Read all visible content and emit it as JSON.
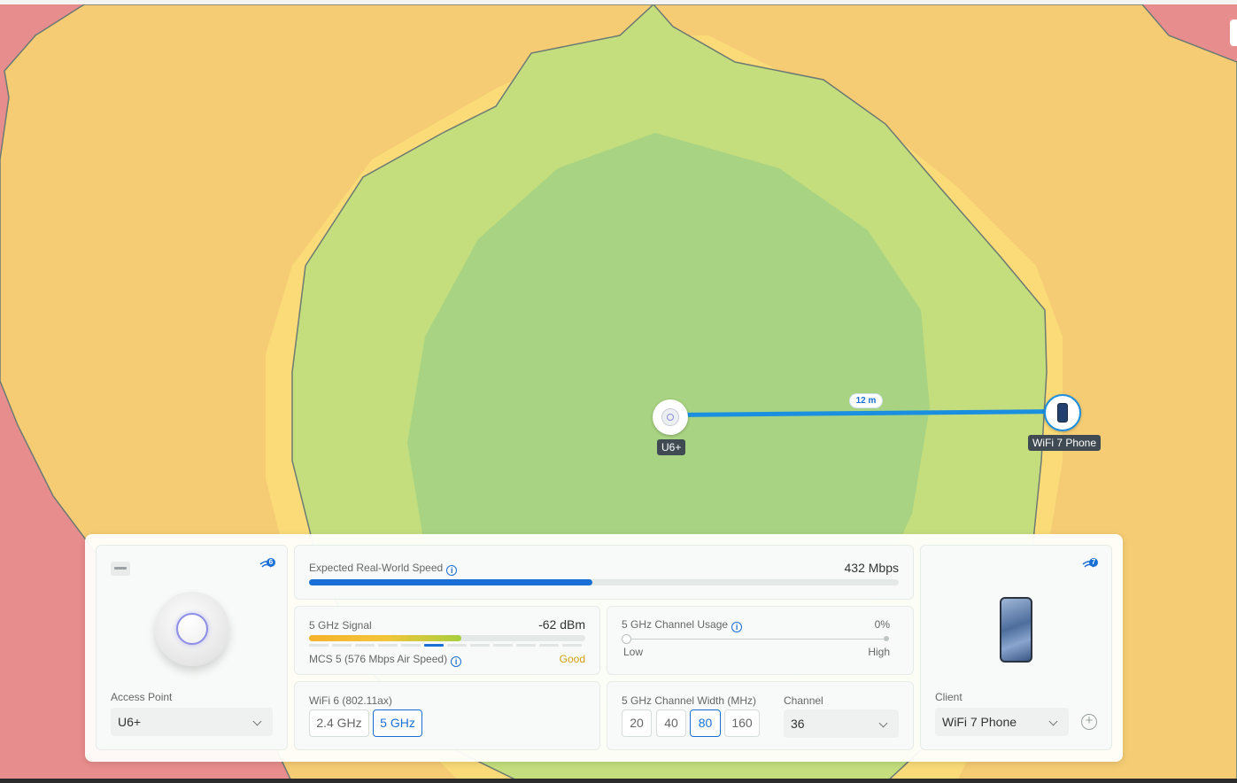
{
  "map": {
    "ap_label": "U6+",
    "client_label": "WiFi 7 Phone",
    "distance_label": "12 m",
    "colors": {
      "weak": "#e88d8d",
      "fair": "#f5cc74",
      "mid": "#fadb78",
      "good": "#c4de7e",
      "strong": "#a8d382"
    }
  },
  "ap_card": {
    "section_label": "Access Point",
    "selected": "U6+",
    "badge": "6"
  },
  "speed": {
    "label": "Expected Real-World Speed",
    "value": "432 Mbps",
    "fraction": 0.48
  },
  "signal": {
    "label": "5 GHz Signal",
    "value": "-62 dBm",
    "mcs": "MCS 5 (576 Mbps Air Speed)",
    "quality": "Good",
    "fraction": 0.55
  },
  "channel_usage": {
    "label": "5 GHz Channel Usage",
    "value": "0%",
    "low": "Low",
    "high": "High"
  },
  "standard": {
    "label": "WiFi 6 (802.11ax)",
    "bands": [
      "2.4 GHz",
      "5 GHz"
    ],
    "selected_band": "5 GHz"
  },
  "channel_width": {
    "label": "5 GHz Channel Width (MHz)",
    "options": [
      "20",
      "40",
      "80",
      "160"
    ],
    "selected": "80"
  },
  "channel": {
    "label": "Channel",
    "selected": "36"
  },
  "client_card": {
    "section_label": "Client",
    "selected": "WiFi 7 Phone",
    "badge": "7"
  }
}
